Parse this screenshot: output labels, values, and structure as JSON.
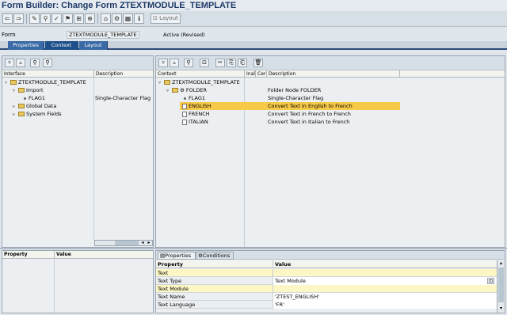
{
  "title": "Form Builder: Change Form ZTEXTMODULE_TEMPLATE",
  "toolbar": {
    "layout_label": "Layout",
    "icons": [
      "back-icon",
      "forward-icon",
      "other-object-icon",
      "display-change-icon",
      "check-icon",
      "activate-icon",
      "test-icon",
      "where-used-icon",
      "hierarchy-icon",
      "settings-icon",
      "grid-icon"
    ]
  },
  "form": {
    "label": "Form",
    "name": "ZTEXTMODULE_TEMPLATE",
    "status": "Active (Revised)"
  },
  "tabs": [
    {
      "label": "Properties",
      "active": false
    },
    {
      "label": "Context",
      "active": true
    },
    {
      "label": "Layout",
      "active": false
    }
  ],
  "interface_panel": {
    "columns": [
      "Interface",
      "Description"
    ],
    "rows": [
      {
        "name": "ZTEXTMODULE_TEMPLATE",
        "desc": "",
        "level": 0,
        "expanded": true,
        "kind": "folder"
      },
      {
        "name": "Import",
        "desc": "",
        "level": 1,
        "expanded": true,
        "kind": "folder"
      },
      {
        "name": "FLAG1",
        "desc": "Single-Character Flag",
        "level": 2,
        "kind": "field"
      },
      {
        "name": "Global Data",
        "desc": "",
        "level": 1,
        "expanded": false,
        "kind": "folder"
      },
      {
        "name": "System Fields",
        "desc": "",
        "level": 1,
        "expanded": false,
        "kind": "folder"
      }
    ]
  },
  "context_panel": {
    "columns": [
      "Context",
      "Inal",
      "Cer",
      "Description"
    ],
    "rows": [
      {
        "name": "ZTEXTMODULE_TEMPLATE",
        "desc": "",
        "level": 0,
        "kind": "folder",
        "selected": false
      },
      {
        "name": "FOLDER",
        "desc": "Folder Node FOLDER",
        "level": 1,
        "kind": "folder",
        "selected": false
      },
      {
        "name": "FLAG1",
        "desc": "Single-Character Flag",
        "level": 2,
        "kind": "field",
        "selected": false
      },
      {
        "name": "ENGLISH",
        "desc": "Convert Text in English to French",
        "level": 2,
        "kind": "text",
        "selected": true
      },
      {
        "name": "FRENCH",
        "desc": "Convert Text in French to French",
        "level": 2,
        "kind": "text",
        "selected": false
      },
      {
        "name": "ITALIAN",
        "desc": "Convert Text in Italian to French",
        "level": 2,
        "kind": "text",
        "selected": false
      }
    ]
  },
  "left_props": {
    "columns": [
      "Property",
      "Value"
    ]
  },
  "right_props": {
    "tabs": [
      "Properties",
      "Conditions"
    ],
    "columns": [
      "Property",
      "Value"
    ],
    "rows": [
      {
        "prop": "Text",
        "value": "",
        "section": true
      },
      {
        "prop": "Text Type",
        "value": "Text Module",
        "section": false
      },
      {
        "prop": "Text Module",
        "value": "",
        "section": true
      },
      {
        "prop": "Text Name",
        "value": "'ZTEST_ENGLISH'",
        "section": false
      },
      {
        "prop": "Text Language",
        "value": "'FR'",
        "section": false
      }
    ]
  }
}
